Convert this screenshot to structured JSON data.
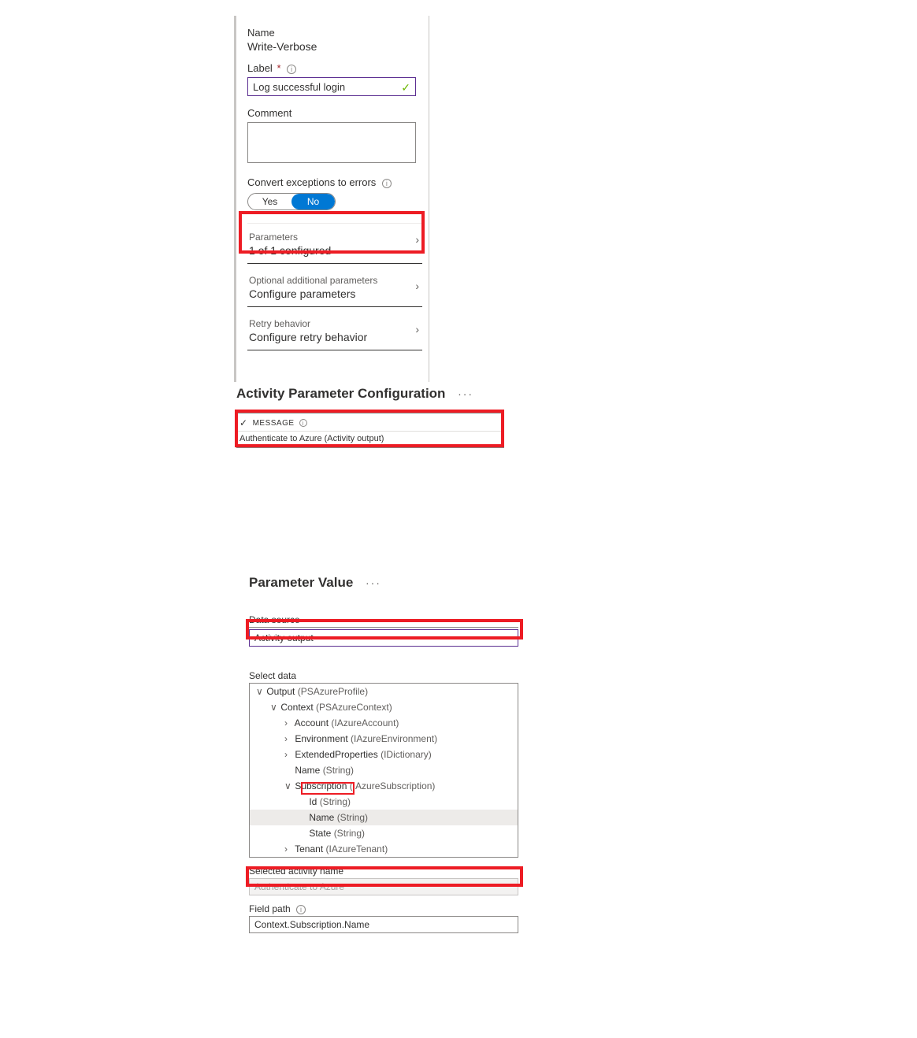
{
  "pane1": {
    "name_label": "Name",
    "name_value": "Write-Verbose",
    "label_label": "Label",
    "label_value": "Log successful login",
    "comment_label": "Comment",
    "comment_value": "",
    "convert_label": "Convert exceptions to errors",
    "toggle_yes": "Yes",
    "toggle_no": "No",
    "rows": [
      {
        "sub": "Parameters",
        "main": "1 of 1 configured"
      },
      {
        "sub": "Optional additional parameters",
        "main": "Configure parameters"
      },
      {
        "sub": "Retry behavior",
        "main": "Configure retry behavior"
      }
    ]
  },
  "sec2": {
    "title": "Activity Parameter Configuration",
    "msg_header": "MESSAGE",
    "msg_body": "Authenticate to Azure (Activity output)"
  },
  "sec3": {
    "title": "Parameter Value",
    "data_source_label": "Data source",
    "data_source_value": "Activity output",
    "select_data_label": "Select data",
    "tree": [
      {
        "level": 0,
        "tw": "v",
        "name": "Output",
        "type": "(PSAzureProfile)"
      },
      {
        "level": 1,
        "tw": "v",
        "name": "Context",
        "type": "(PSAzureContext)"
      },
      {
        "level": 2,
        "tw": ">",
        "name": "Account",
        "type": "(IAzureAccount)"
      },
      {
        "level": 2,
        "tw": ">",
        "name": "Environment",
        "type": "(IAzureEnvironment)"
      },
      {
        "level": 2,
        "tw": ">",
        "name": "ExtendedProperties",
        "type": "(IDictionary)"
      },
      {
        "level": 2,
        "tw": "",
        "name": "Name",
        "type": "(String)"
      },
      {
        "level": 2,
        "tw": "v",
        "name": "Subscription",
        "type": "(IAzureSubscription)"
      },
      {
        "level": 3,
        "tw": "",
        "name": "Id",
        "type": "(String)"
      },
      {
        "level": 3,
        "tw": "",
        "name": "Name",
        "type": "(String)",
        "sel": true
      },
      {
        "level": 3,
        "tw": "",
        "name": "State",
        "type": "(String)"
      },
      {
        "level": 2,
        "tw": ">",
        "name": "Tenant",
        "type": "(IAzureTenant)"
      }
    ],
    "selected_activity_label": "Selected activity name",
    "selected_activity_value": "Authenticate to Azure",
    "field_path_label": "Field path",
    "field_path_value": "Context.Subscription.Name"
  }
}
